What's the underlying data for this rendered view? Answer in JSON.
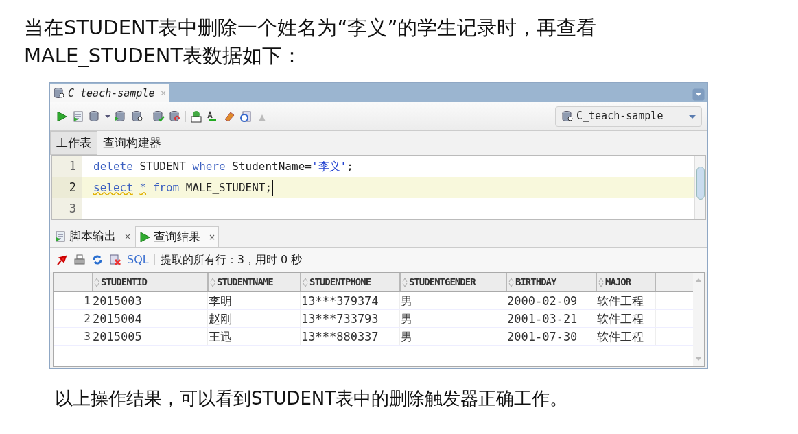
{
  "heading_lines": [
    "当在STUDENT表中删除一个姓名为“李义”的学生记录时，再查看",
    "MALE_STUDENT表数据如下："
  ],
  "window": {
    "document_tabs": [
      {
        "label": "C_teach-sample",
        "selected": true,
        "close": "×"
      }
    ],
    "connection": "C_teach-sample",
    "editor_tabs": [
      {
        "label": "工作表",
        "selected": true
      },
      {
        "label": "查询构建器",
        "selected": false
      }
    ],
    "editor_lines": [
      {
        "number": "1",
        "current": false,
        "tokens": [
          {
            "kind": "keyword",
            "text": "delete"
          },
          {
            "kind": "plain",
            "text": " STUDENT "
          },
          {
            "kind": "keyword",
            "text": "where"
          },
          {
            "kind": "plain",
            "text": " StudentName="
          },
          {
            "kind": "string",
            "text": "'李义'"
          },
          {
            "kind": "plain",
            "text": ";"
          }
        ]
      },
      {
        "number": "2",
        "current": true,
        "tokens": [
          {
            "kind": "keyword",
            "text": "select",
            "warning": true
          },
          {
            "kind": "keyword",
            "text": "*",
            "warning": true,
            "spaced": true
          },
          {
            "kind": "keyword",
            "text": "from",
            "spaced": true
          },
          {
            "kind": "plain",
            "text": " MALE_STUDENT;"
          }
        ]
      },
      {
        "number": "3",
        "current": false
      }
    ],
    "result_tabs": [
      {
        "kind": "script",
        "label": "脚本输出",
        "close": "×",
        "selected": false
      },
      {
        "kind": "query",
        "label": "查询结果",
        "close": "×",
        "selected": true
      }
    ],
    "result_toolbar": {
      "sql_link": "SQL",
      "status": "提取的所有行：3，用时 0 秒"
    },
    "grid": {
      "columns": [
        "STUDENTID",
        "STUDENTNAME",
        "STUDENTPHONE",
        "STUDENTGENDER",
        "BIRTHDAY",
        "MAJOR"
      ],
      "rows": [
        {
          "number": "1",
          "cells": [
            "2015003",
            "李明",
            "13***379374",
            "男",
            "2000-02-09",
            "软件工程"
          ]
        },
        {
          "number": "2",
          "cells": [
            "2015004",
            "赵刚",
            "13***733793",
            "男",
            "2001-03-21",
            "软件工程"
          ]
        },
        {
          "number": "3",
          "cells": [
            "2015005",
            "王迅",
            "13***880337",
            "男",
            "2001-07-30",
            "软件工程"
          ]
        }
      ]
    }
  },
  "conclusion": "以上操作结果，可以看到STUDENT表中的删除触发器正确工作。"
}
